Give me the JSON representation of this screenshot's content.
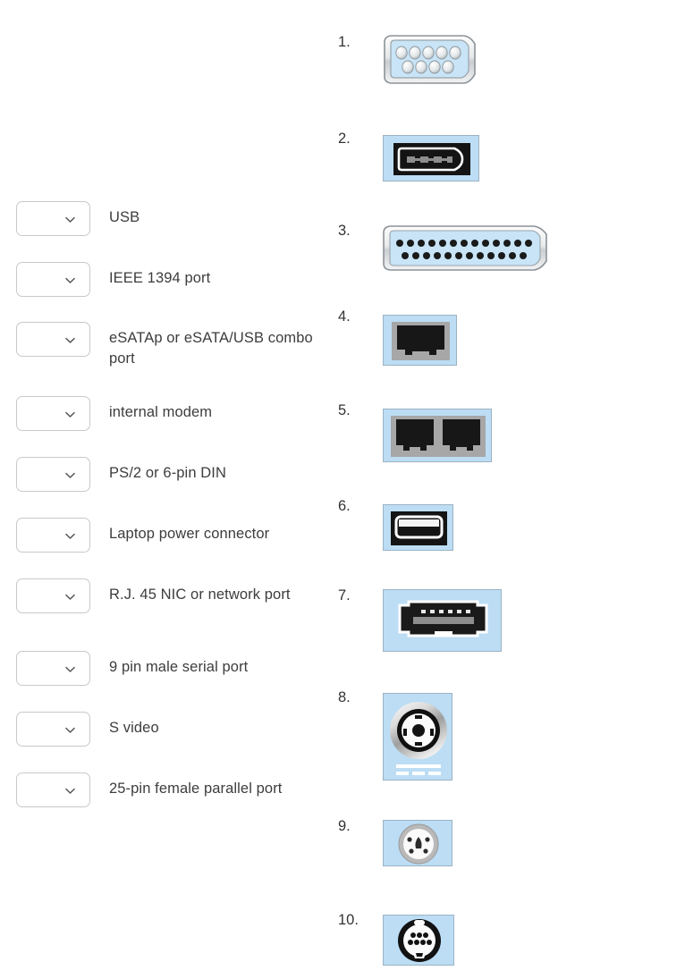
{
  "page": {
    "type": "matching-exercise",
    "background": "#ffffff",
    "text_color": "#3d3d3d",
    "number_color": "#333333",
    "plate_color": "#bcddf4",
    "dropdown_border_color": "#c9c9c9"
  },
  "match_rows": [
    {
      "id": "row-1",
      "label": "USB",
      "dropdown_value": "",
      "chevron": "chevron-down-icon"
    },
    {
      "id": "row-2",
      "label": "IEEE 1394 port",
      "dropdown_value": "",
      "chevron": "chevron-down-icon"
    },
    {
      "id": "row-3",
      "label": "eSATAp or eSATA/USB combo port",
      "dropdown_value": "",
      "chevron": "chevron-down-icon"
    },
    {
      "id": "row-4",
      "label": "internal modem",
      "dropdown_value": "",
      "chevron": "chevron-down-icon"
    },
    {
      "id": "row-5",
      "label": "PS/2 or 6-pin DIN",
      "dropdown_value": "",
      "chevron": "chevron-down-icon"
    },
    {
      "id": "row-6",
      "label": "Laptop power connector",
      "dropdown_value": "",
      "chevron": "chevron-down-icon"
    },
    {
      "id": "row-7",
      "label": "R.J. 45 NIC or network port",
      "dropdown_value": "",
      "chevron": "chevron-down-icon"
    },
    {
      "id": "row-8",
      "label": "9 pin male serial port",
      "dropdown_value": "",
      "chevron": "chevron-down-icon"
    },
    {
      "id": "row-9",
      "label": "S video",
      "dropdown_value": "",
      "chevron": "chevron-down-icon"
    },
    {
      "id": "row-10",
      "label": "25-pin female parallel port",
      "dropdown_value": "",
      "chevron": "chevron-down-icon"
    }
  ],
  "connectors": [
    {
      "number": "1.",
      "icon": "db9-serial-port-icon",
      "description": "9 pin male serial port"
    },
    {
      "number": "2.",
      "icon": "ieee1394-firewire-port-icon",
      "description": "IEEE 1394 port"
    },
    {
      "number": "3.",
      "icon": "db25-parallel-port-icon",
      "description": "25-pin female parallel port"
    },
    {
      "number": "4.",
      "icon": "rj45-network-port-icon",
      "description": "R.J. 45 NIC or network port"
    },
    {
      "number": "5.",
      "icon": "rj11-modem-port-icon",
      "description": "internal modem"
    },
    {
      "number": "6.",
      "icon": "usb-port-icon",
      "description": "USB"
    },
    {
      "number": "7.",
      "icon": "esatap-port-icon",
      "description": "eSATAp or eSATA/USB combo port"
    },
    {
      "number": "8.",
      "icon": "laptop-power-connector-icon",
      "description": "Laptop power connector"
    },
    {
      "number": "9.",
      "icon": "s-video-port-icon",
      "description": "S video"
    },
    {
      "number": "10.",
      "icon": "ps2-mini-din-port-icon",
      "description": "PS/2 or 6-pin DIN"
    }
  ]
}
